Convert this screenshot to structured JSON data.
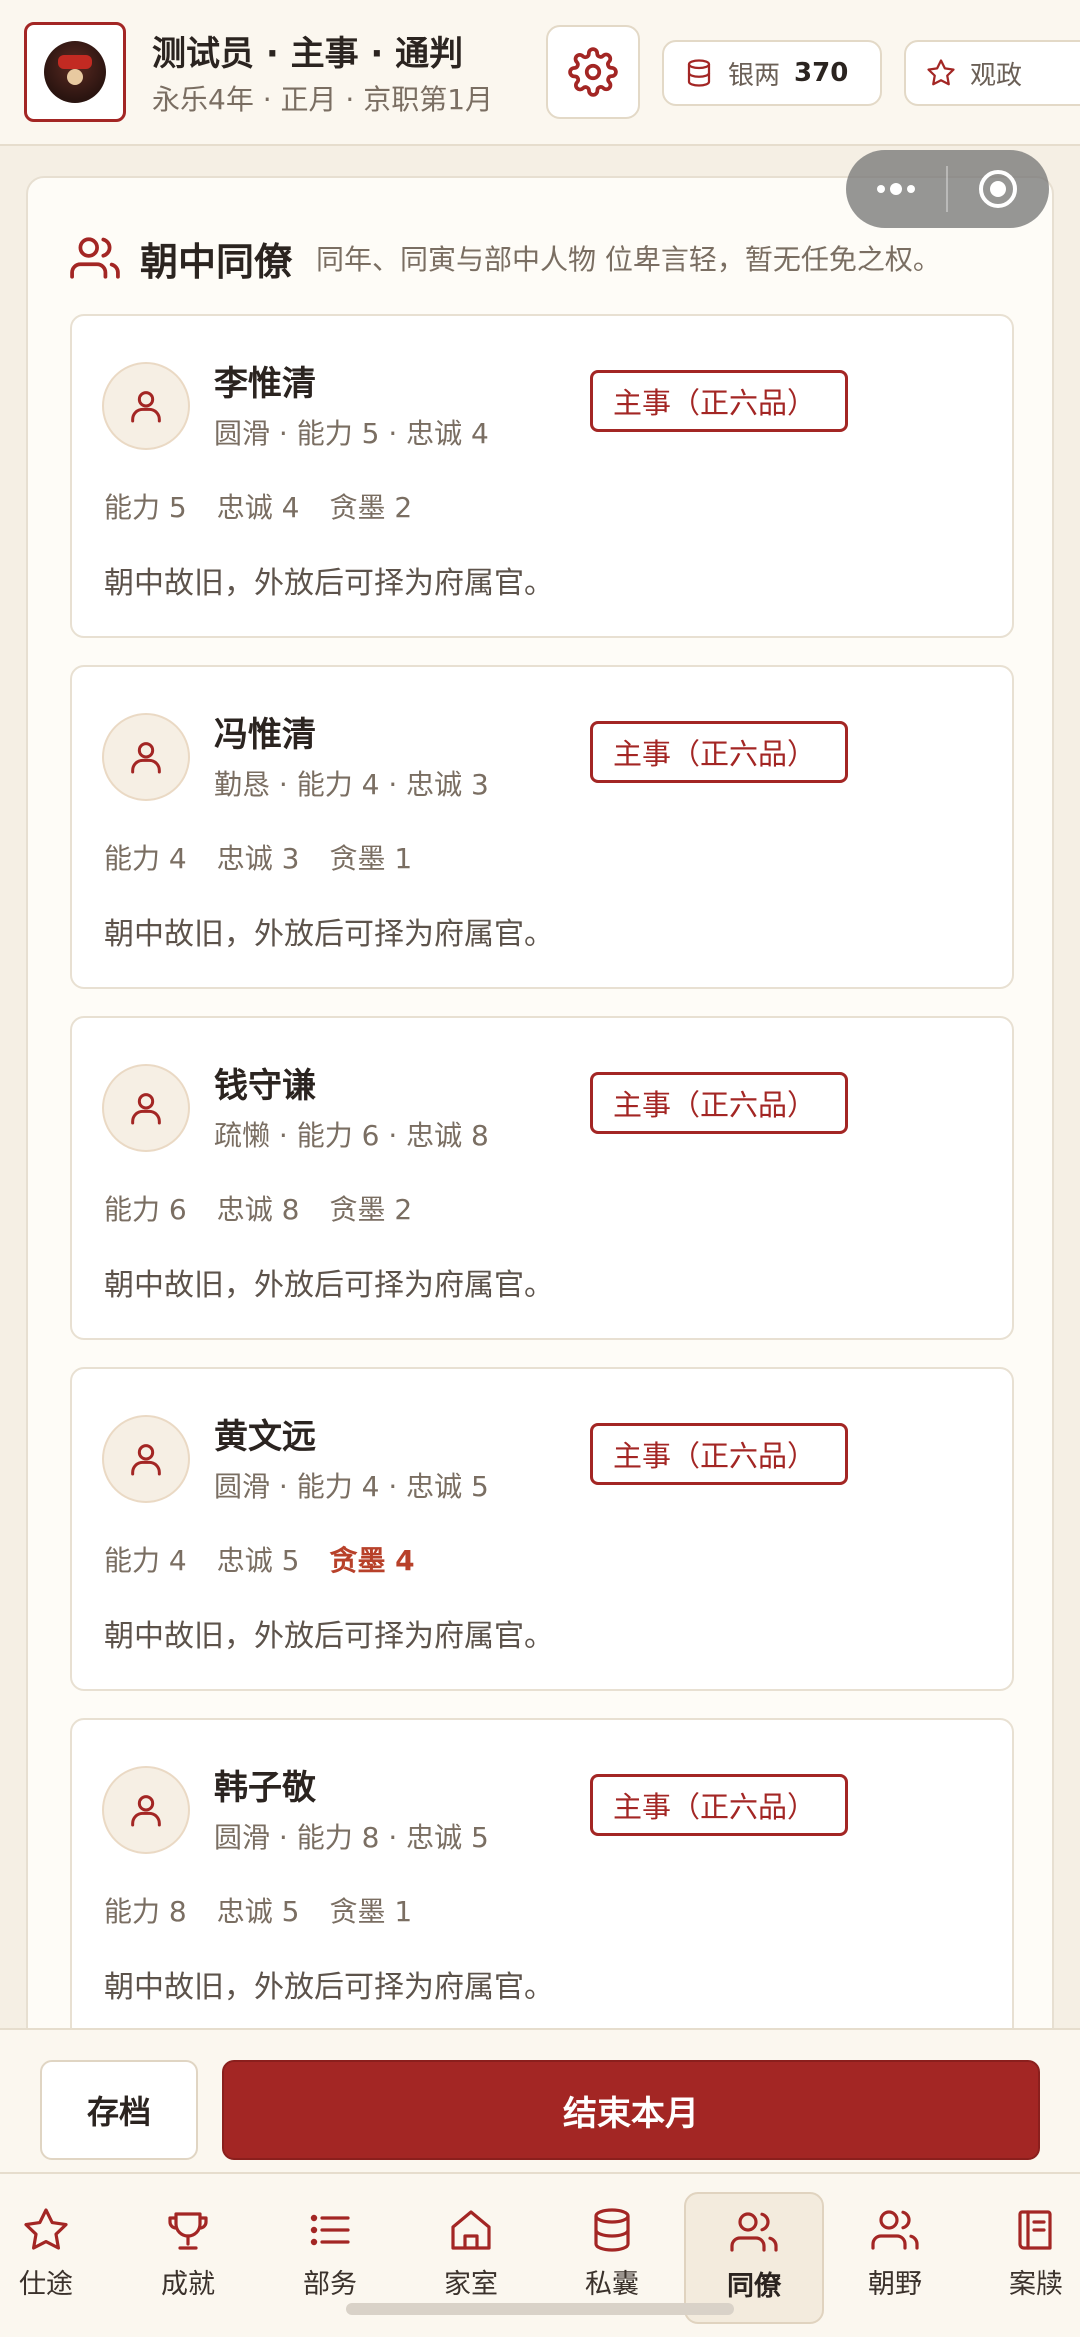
{
  "header": {
    "title": "测试员 · 主事 · 通判",
    "subtitle": "永乐4年 · 正月 · 京职第1月",
    "silver_label": "银两",
    "silver_value": "370",
    "watch_label": "观政"
  },
  "section": {
    "title": "朝中同僚",
    "description": "同年、同寅与部中人物  位卑言轻，暂无任免之权。"
  },
  "colleagues": [
    {
      "name": "李惟清",
      "traits": "圆滑 · 能力 5 · 忠诚 4",
      "rank": "主事（正六品）",
      "ability": "能力 5",
      "loyalty": "忠诚 4",
      "greed": "贪墨 2",
      "note": "朝中故旧，外放后可择为府属官。"
    },
    {
      "name": "冯惟清",
      "traits": "勤恳 · 能力 4 · 忠诚 3",
      "rank": "主事（正六品）",
      "ability": "能力 4",
      "loyalty": "忠诚 3",
      "greed": "贪墨 1",
      "note": "朝中故旧，外放后可择为府属官。"
    },
    {
      "name": "钱守谦",
      "traits": "疏懒 · 能力 6 · 忠诚 8",
      "rank": "主事（正六品）",
      "ability": "能力 6",
      "loyalty": "忠诚 8",
      "greed": "贪墨 2",
      "note": "朝中故旧，外放后可择为府属官。"
    },
    {
      "name": "黄文远",
      "traits": "圆滑 · 能力 4 · 忠诚 5",
      "rank": "主事（正六品）",
      "ability": "能力 4",
      "loyalty": "忠诚 5",
      "greed": "贪墨 4",
      "note": "朝中故旧，外放后可择为府属官。"
    },
    {
      "name": "韩子敬",
      "traits": "圆滑 · 能力 8 · 忠诚 5",
      "rank": "主事（正六品）",
      "ability": "能力 8",
      "loyalty": "忠诚 5",
      "greed": "贪墨 1",
      "note": "朝中故旧，外放后可择为府属官。"
    }
  ],
  "actions": {
    "save": "存档",
    "end_month": "结束本月"
  },
  "nav": [
    {
      "label": "仕途",
      "icon": "star-icon"
    },
    {
      "label": "成就",
      "icon": "trophy-icon"
    },
    {
      "label": "部务",
      "icon": "list-icon"
    },
    {
      "label": "家室",
      "icon": "home-icon"
    },
    {
      "label": "私囊",
      "icon": "coins-icon"
    },
    {
      "label": "同僚",
      "icon": "users-icon"
    },
    {
      "label": "朝野",
      "icon": "users-icon"
    },
    {
      "label": "案牍",
      "icon": "book-icon"
    }
  ],
  "colors": {
    "accent": "#a32624",
    "warn": "#b8412a",
    "background": "#f5efe4"
  }
}
